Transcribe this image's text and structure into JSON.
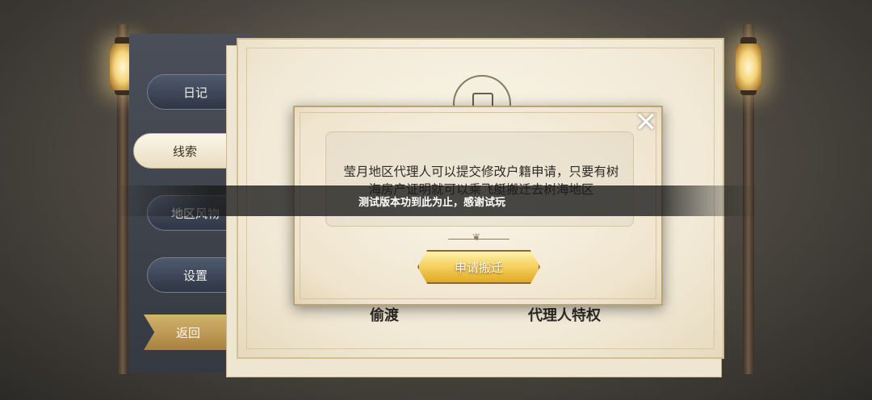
{
  "sidebar": {
    "items": [
      {
        "label": "日记"
      },
      {
        "label": "线索"
      },
      {
        "label": "地区风物"
      },
      {
        "label": "设置"
      }
    ],
    "back_label": "返回",
    "selected": "线索"
  },
  "cards": {
    "left_label": "偷渡",
    "right_label": "代理人特权"
  },
  "dialog": {
    "message": "莹月地区代理人可以提交修改户籍申请，只要有树海房产证明就可以乘飞艇搬迁去树海地区",
    "apply_label": "申请搬迁",
    "close_icon": "close-icon"
  },
  "toast": {
    "text": "测试版本功到此为止，感谢试玩"
  },
  "colors": {
    "accent_gold": "#e0a92a",
    "tab_dark": "#2f3645",
    "paper": "#f1e8d4"
  }
}
